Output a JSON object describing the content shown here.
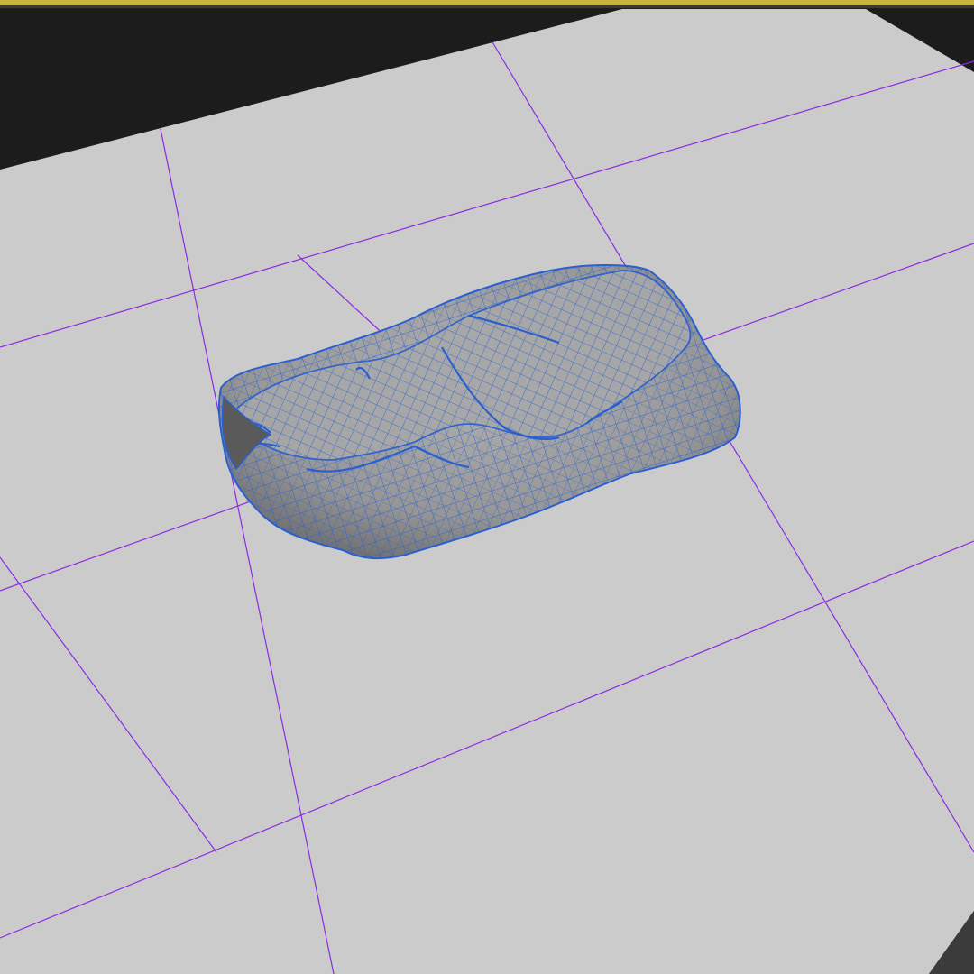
{
  "viewport": {
    "view_type": "perspective",
    "shading_mode": "shaded-with-wireframe",
    "active_border_color": "#c8b43c",
    "background_color": "#1c1c1c",
    "ground_plane_color": "#cbcbcb",
    "grid_line_color": "#8a2be2"
  },
  "scene": {
    "objects": [
      {
        "name": "folded-cloth-mesh",
        "shading_color": "#9a9a9a",
        "wireframe_color": "#2a5fd0",
        "selected": true
      }
    ]
  }
}
